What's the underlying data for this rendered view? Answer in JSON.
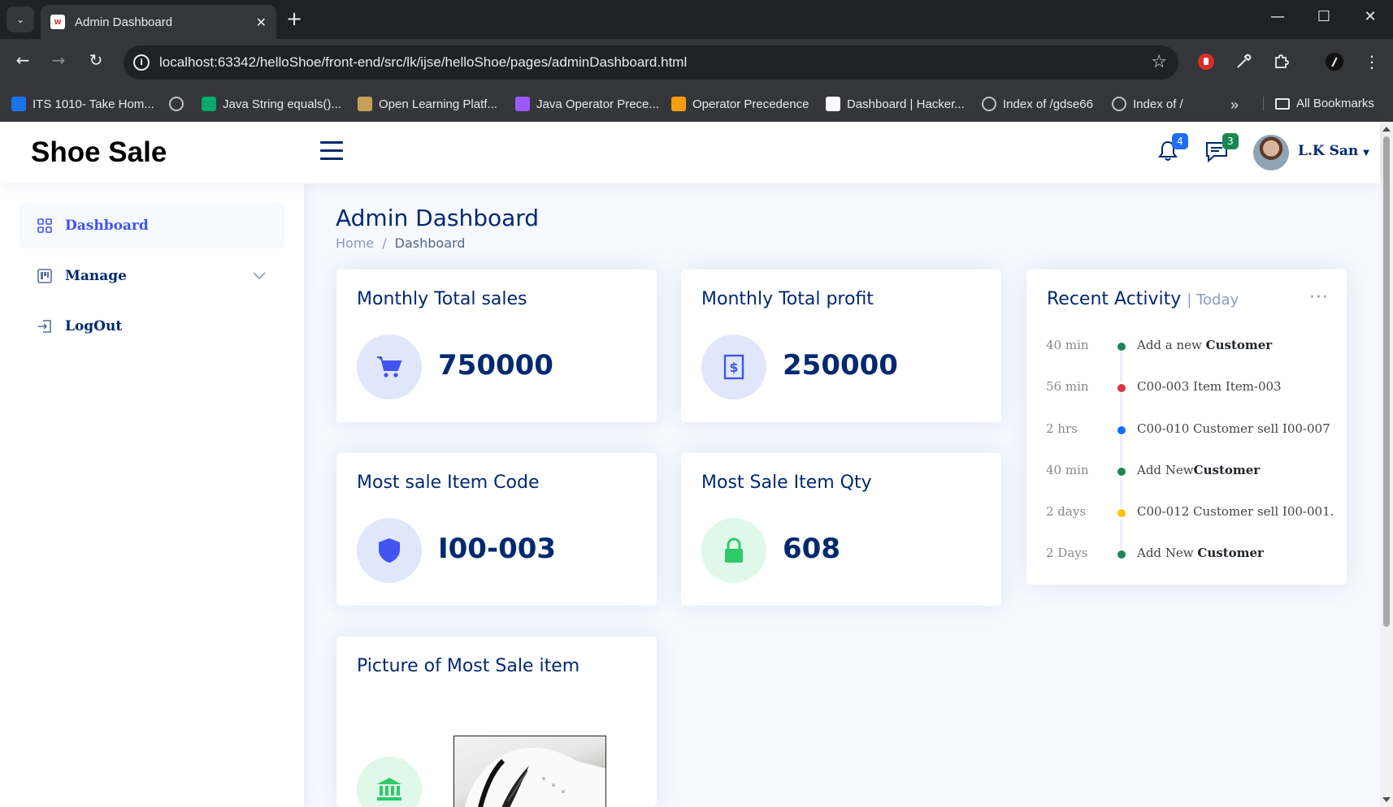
{
  "browser": {
    "tab_title": "Admin Dashboard",
    "favicon_text": "W",
    "url": "localhost:63342/helloShoe/front-end/src/lk/ijse/helloShoe/pages/adminDashboard.html",
    "bookmarks": [
      {
        "label": "ITS 1010- Take Hom...",
        "icon": "classroom-icon",
        "color": "#1a73e8"
      },
      {
        "label": "",
        "icon": "github-icon",
        "color": "#e8eaed"
      },
      {
        "label": "Java String equals()...",
        "icon": "w3-icon",
        "color": "#04aa6d"
      },
      {
        "label": "Open Learning Platf...",
        "icon": "olp-icon",
        "color": "#c6a15b"
      },
      {
        "label": "Java Operator Prece...",
        "icon": "prece-icon",
        "color": "#9b59ff"
      },
      {
        "label": "Operator Precedence",
        "icon": "op-icon",
        "color": "#f59e0b"
      },
      {
        "label": "Dashboard | Hacker...",
        "icon": "hackerrank-icon",
        "color": "#ffffff"
      },
      {
        "label": "Index of /gdse66",
        "icon": "globe-icon",
        "color": "#e8eaed"
      },
      {
        "label": "Index of /",
        "icon": "globe-icon",
        "color": "#e8eaed"
      }
    ],
    "more_label": "»",
    "all_bookmarks": "All Bookmarks"
  },
  "header": {
    "logo": "Shoe Sale",
    "notifications_count": "4",
    "messages_count": "3",
    "user_name": "L.K San"
  },
  "sidebar": {
    "items": [
      {
        "label": "Dashboard"
      },
      {
        "label": "Manage"
      },
      {
        "label": "LogOut"
      }
    ]
  },
  "main": {
    "title": "Admin Dashboard",
    "breadcrumb": {
      "home": "Home",
      "separator": "/",
      "current": "Dashboard"
    },
    "cards": {
      "sales": {
        "title": "Monthly Total sales",
        "value": "750000"
      },
      "profit": {
        "title": "Monthly Total profit",
        "value": "250000"
      },
      "item_code": {
        "title": "Most sale Item Code",
        "value": "I00-003"
      },
      "item_qty": {
        "title": "Most Sale Item Qty",
        "value": "608"
      },
      "picture": {
        "title": "Picture of Most Sale item"
      }
    },
    "activity": {
      "title": "Recent Activity",
      "filter": "| Today",
      "dots": "···",
      "items": [
        {
          "time": "40 min",
          "text": "Add a new ",
          "bold": "Customer",
          "color": "#198754"
        },
        {
          "time": "56 min",
          "text": "C00-003 Item Item-003",
          "bold": "",
          "color": "#dc3545"
        },
        {
          "time": "2 hrs",
          "text": "C00-010 Customer sell I00-007",
          "bold": "",
          "color": "#0d6efd"
        },
        {
          "time": "40 min",
          "text": "Add New",
          "bold": "Customer",
          "color": "#198754"
        },
        {
          "time": "2 days",
          "text": "C00-012 Customer sell I00-001.",
          "bold": "",
          "color": "#ffc107"
        },
        {
          "time": "2 Days",
          "text": "Add New ",
          "bold": "Customer",
          "color": "#198754"
        }
      ]
    }
  }
}
